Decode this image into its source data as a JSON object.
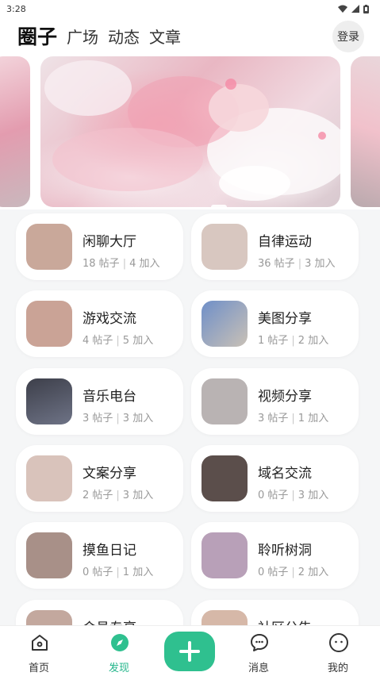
{
  "status_bar": {
    "time": "3:28"
  },
  "header": {
    "tabs": [
      {
        "label": "圈子"
      },
      {
        "label": "广场"
      },
      {
        "label": "动态"
      },
      {
        "label": "文章"
      }
    ],
    "login_label": "登录"
  },
  "circles": [
    {
      "name": "闲聊大厅",
      "posts": "18 帖子",
      "joined": "4 加入",
      "avatar_color": "#c9a89a"
    },
    {
      "name": "自律运动",
      "posts": "36 帖子",
      "joined": "3 加入",
      "avatar_color": "#d8c7c0"
    },
    {
      "name": "游戏交流",
      "posts": "4 帖子",
      "joined": "5 加入",
      "avatar_color": "#caa396"
    },
    {
      "name": "美图分享",
      "posts": "1 帖子",
      "joined": "2 加入",
      "avatar_color": "#7d8fb0"
    },
    {
      "name": "音乐电台",
      "posts": "3 帖子",
      "joined": "3 加入",
      "avatar_color": "#4b4f5e"
    },
    {
      "name": "视频分享",
      "posts": "3 帖子",
      "joined": "1 加入",
      "avatar_color": "#b9b3b3"
    },
    {
      "name": "文案分享",
      "posts": "2 帖子",
      "joined": "3 加入",
      "avatar_color": "#d9c3bb"
    },
    {
      "name": "域名交流",
      "posts": "0 帖子",
      "joined": "3 加入",
      "avatar_color": "#5b4e4b"
    },
    {
      "name": "摸鱼日记",
      "posts": "0 帖子",
      "joined": "1 加入",
      "avatar_color": "#a89088"
    },
    {
      "name": "聆听树洞",
      "posts": "0 帖子",
      "joined": "2 加入",
      "avatar_color": "#b8a0b8"
    },
    {
      "name": "会员专享",
      "posts": "",
      "joined": "",
      "avatar_color": "#c3a89e"
    },
    {
      "name": "社区公告",
      "posts": "",
      "joined": "",
      "avatar_color": "#d6b8a8"
    }
  ],
  "tabbar": {
    "items": [
      {
        "label": "首页",
        "icon": "home-icon"
      },
      {
        "label": "发现",
        "icon": "compass-icon"
      },
      {
        "label": "消息",
        "icon": "chat-icon"
      },
      {
        "label": "我的",
        "icon": "profile-icon"
      }
    ],
    "add_icon": "plus-icon"
  },
  "colors": {
    "accent": "#2fc08f",
    "accent_text": "#22b58a"
  }
}
